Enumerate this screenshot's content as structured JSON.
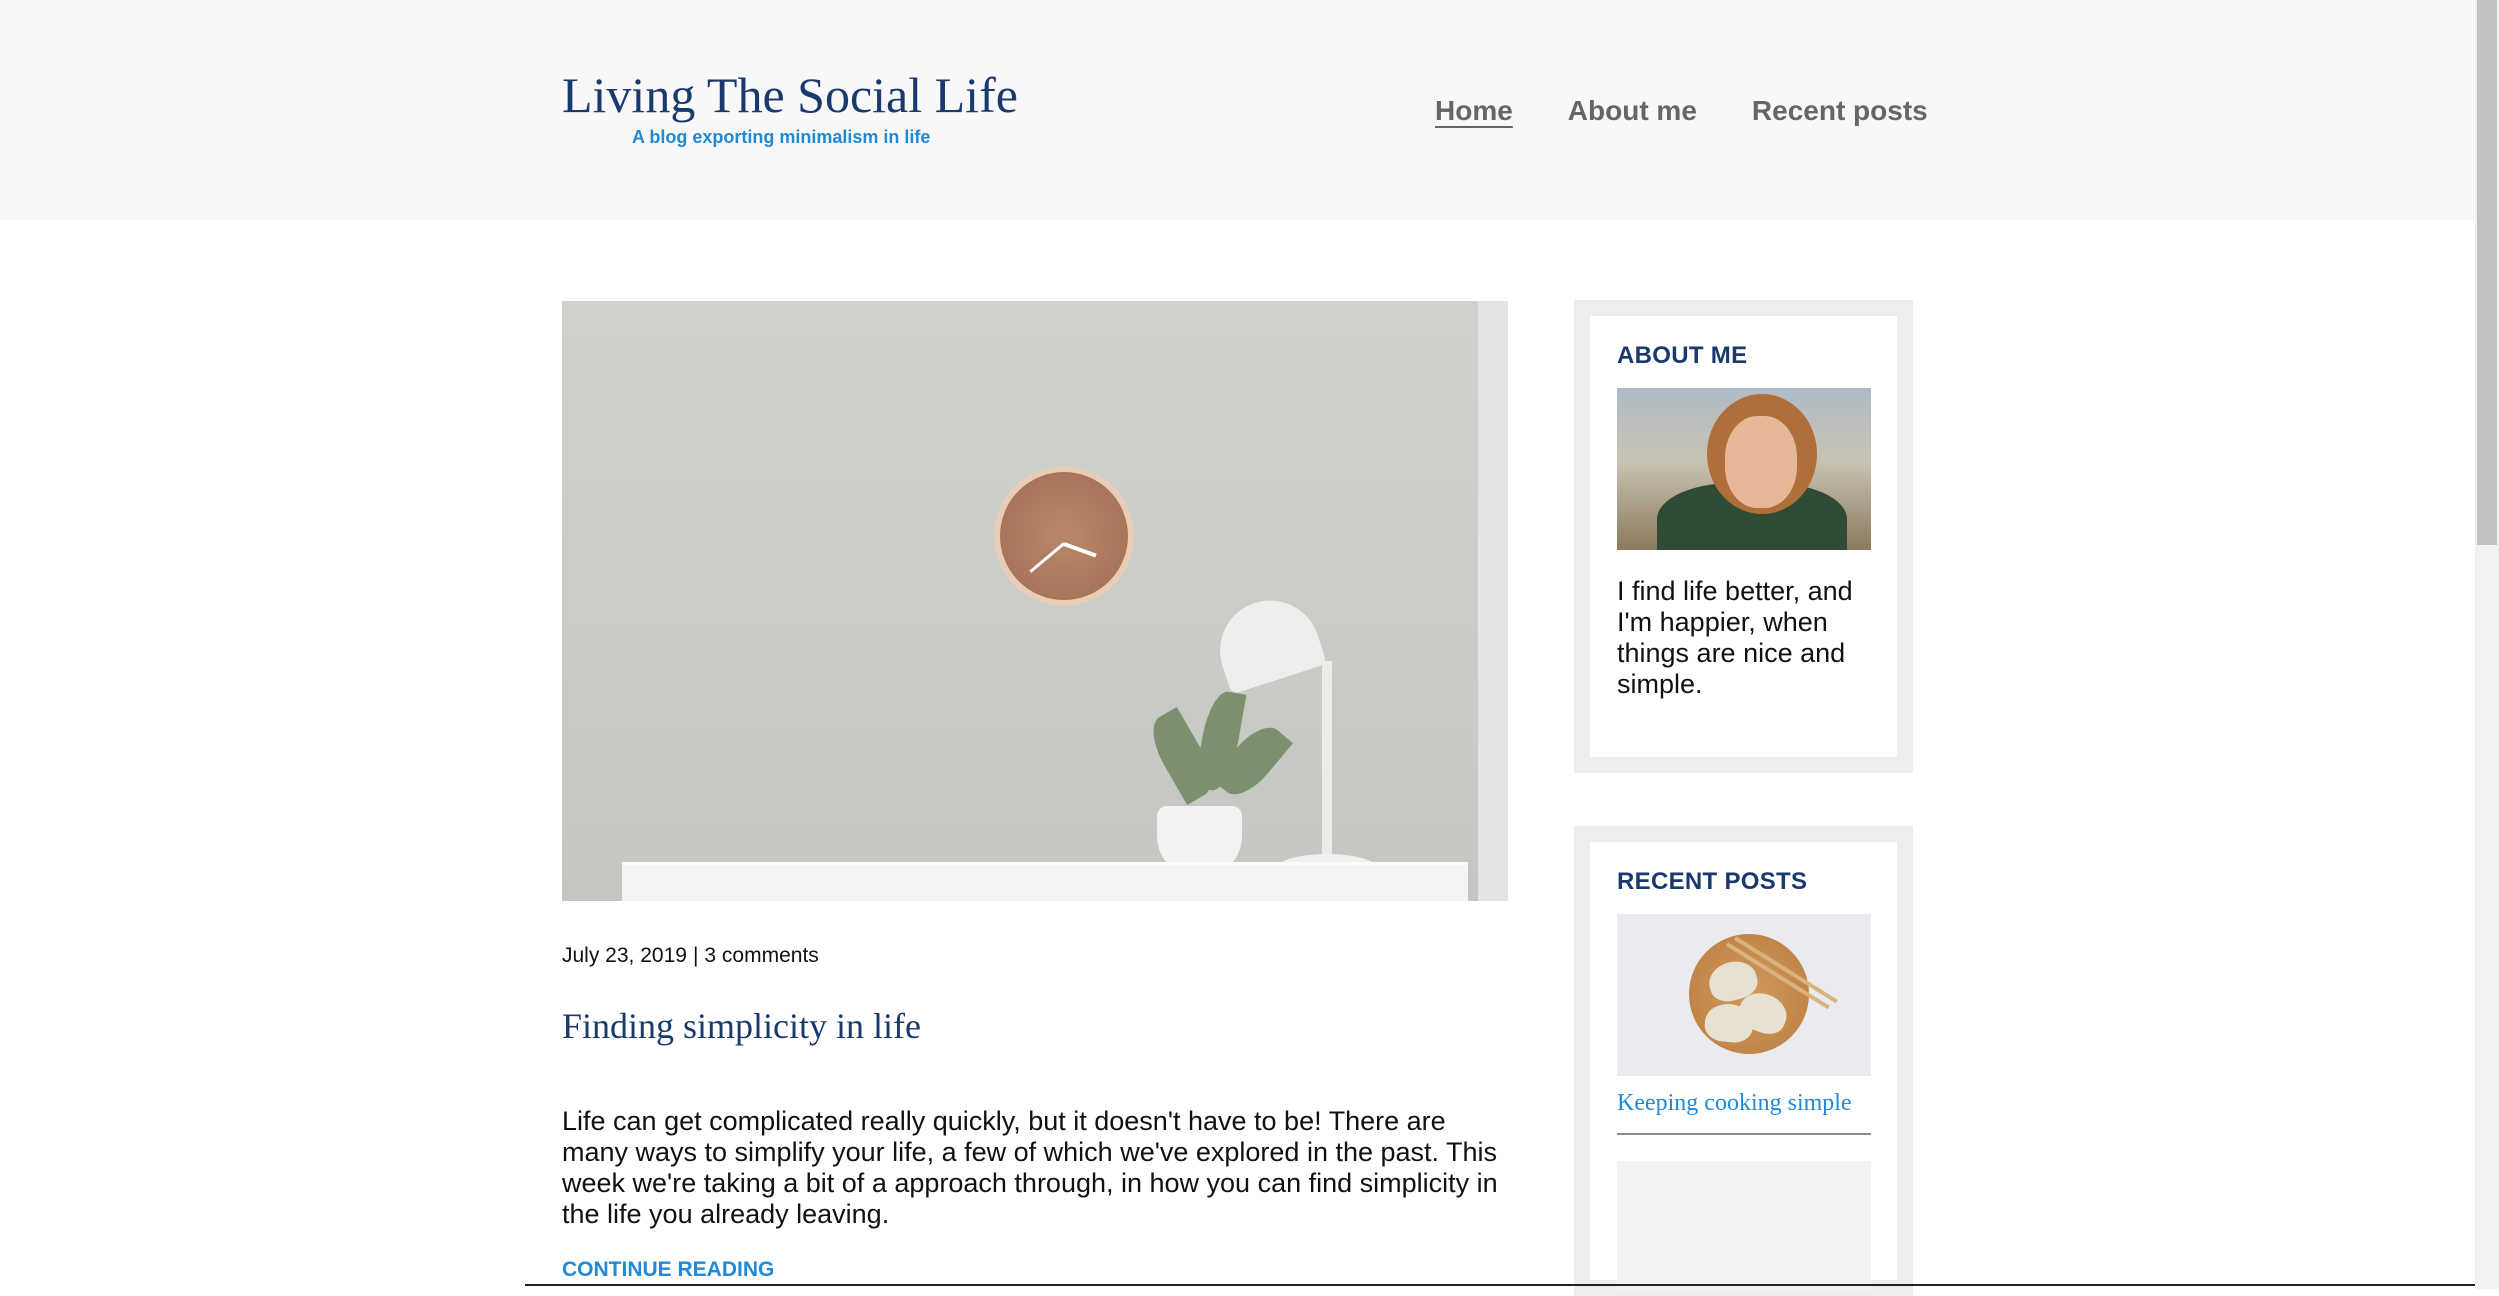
{
  "site": {
    "title": "Living The Social Life",
    "tagline": "A blog exporting minimalism in life"
  },
  "nav": {
    "items": [
      {
        "label": "Home",
        "active": true
      },
      {
        "label": "About me",
        "active": false
      },
      {
        "label": "Recent posts",
        "active": false
      }
    ]
  },
  "post": {
    "date": "July 23, 2019",
    "separator": "|",
    "comments": "3 comments",
    "title": "Finding simplicity in life",
    "excerpt": "Life can get complicated really quickly, but it doesn't have to be! There are many ways to simplify your life, a few of which we've explored in the past. This week we're taking a bit of a approach through, in how you can find simplicity in the life you already leaving.",
    "continue_label": "CONTINUE READING"
  },
  "sidebar": {
    "about": {
      "heading": "ABOUT ME",
      "text": "I find life better, and I'm happier, when things are nice and simple."
    },
    "recent": {
      "heading": "RECENT POSTS",
      "items": [
        {
          "title": "Keeping cooking simple"
        }
      ]
    }
  },
  "colors": {
    "brand_navy": "#1a3a6e",
    "accent_blue": "#1f8ad6",
    "header_bg": "#f8f8f8",
    "widget_border": "#ededed"
  }
}
